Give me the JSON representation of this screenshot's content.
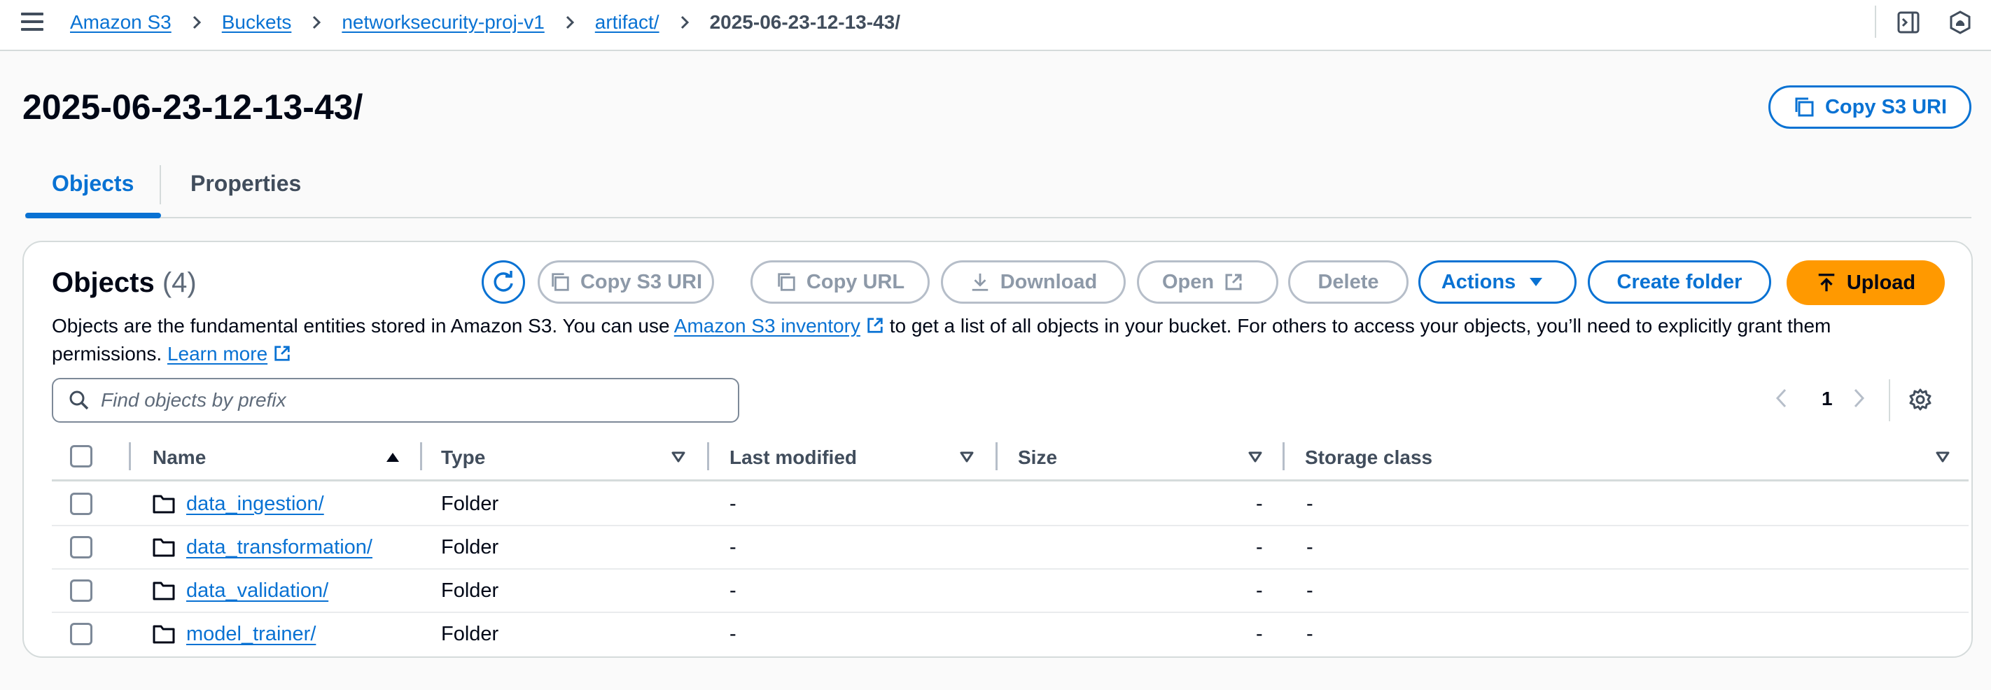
{
  "breadcrumbs": [
    {
      "label": "Amazon S3"
    },
    {
      "label": "Buckets"
    },
    {
      "label": "networksecurity-proj-v1"
    },
    {
      "label": "artifact/"
    }
  ],
  "breadcrumb_current": "2025-06-23-12-13-43/",
  "page": {
    "title": "2025-06-23-12-13-43/",
    "copy_uri_label": "Copy S3 URI"
  },
  "tabs": [
    {
      "label": "Objects",
      "active": true
    },
    {
      "label": "Properties",
      "active": false
    }
  ],
  "objects_panel": {
    "title": "Objects",
    "count": "(4)",
    "toolbar": {
      "copy_s3_uri": "Copy S3 URI",
      "copy_url": "Copy URL",
      "download": "Download",
      "open": "Open",
      "delete": "Delete",
      "actions": "Actions",
      "create_folder": "Create folder",
      "upload": "Upload"
    },
    "description_part1": "Objects are the fundamental entities stored in Amazon S3. You can use",
    "inventory_link": "Amazon S3 inventory",
    "description_part2": "to get a list of all objects in your bucket. For others to access your objects, you’ll need to explicitly grant them permissions.",
    "learn_more": "Learn more",
    "search_placeholder": "Find objects by prefix",
    "page_number": "1"
  },
  "table": {
    "columns": [
      "Name",
      "Type",
      "Last modified",
      "Size",
      "Storage class"
    ],
    "sorted_column": "Name",
    "sort_direction": "ascending",
    "rows": [
      {
        "name": "data_ingestion/",
        "type": "Folder",
        "last_modified": "-",
        "size": "-",
        "storage_class": "-"
      },
      {
        "name": "data_transformation/",
        "type": "Folder",
        "last_modified": "-",
        "size": "-",
        "storage_class": "-"
      },
      {
        "name": "data_validation/",
        "type": "Folder",
        "last_modified": "-",
        "size": "-",
        "storage_class": "-"
      },
      {
        "name": "model_trainer/",
        "type": "Folder",
        "last_modified": "-",
        "size": "-",
        "storage_class": "-"
      }
    ]
  },
  "colors": {
    "accent": "#0972d3",
    "primary_button": "#ff9900",
    "disabled": "#8d99a8",
    "border": "#d5dbdb"
  },
  "icons": [
    "menu-icon",
    "chevron-right-icon",
    "side-panel-icon",
    "notification-icon",
    "copy-icon",
    "refresh-icon",
    "download-icon",
    "external-link-icon",
    "caret-down-icon",
    "upload-icon",
    "search-icon",
    "chevron-left-icon",
    "gear-icon",
    "sort-ascending-icon",
    "sort-icon",
    "folder-icon"
  ]
}
